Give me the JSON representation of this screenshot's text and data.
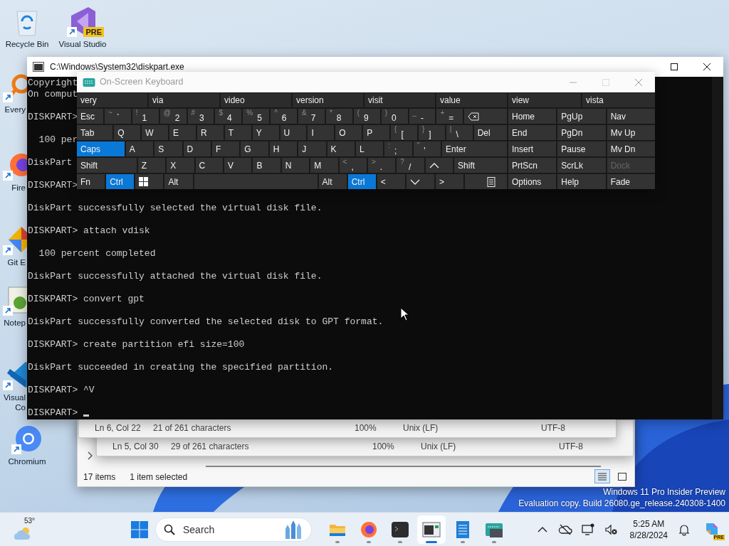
{
  "desktop_icons": [
    {
      "label": "Recycle Bin",
      "kind": "recycle"
    },
    {
      "label": "Visual Studio",
      "kind": "vs",
      "badge": "PRE"
    },
    {
      "label": "Every",
      "kind": "everything"
    },
    {
      "label": "Fire",
      "kind": "firefox"
    },
    {
      "label": "Git E",
      "kind": "git"
    },
    {
      "label": "Notep",
      "kind": "notepadpp"
    },
    {
      "label": "Visual Co",
      "kind": "vscode"
    },
    {
      "label": "Chromium",
      "kind": "chromium"
    }
  ],
  "explorer": {
    "item_count": "17 items",
    "selection": "1 item selected",
    "views": [
      {
        "kind": "details",
        "selected": true
      },
      {
        "kind": "tiles",
        "selected": false
      }
    ]
  },
  "notepad_status_bars": [
    {
      "cells": [
        "Ln 6, Col 22",
        "21 of 261 characters",
        "100%",
        "Unix (LF)",
        "UTF-8"
      ]
    },
    {
      "cells": [
        "Ln 5, Col 30",
        "29 of 261 characters",
        "100%",
        "Unix (LF)",
        "UTF-8"
      ]
    }
  ],
  "console": {
    "title": "C:\\Windows\\System32\\diskpart.exe",
    "lines": [
      {
        "text": "Copyright"
      },
      {
        "text": "On comput"
      },
      {
        "text": "DISKPART>"
      },
      {
        "text": "  100 per"
      },
      {
        "text": "DiskPart"
      },
      {
        "text": "DISKPART>"
      },
      {
        "text": "DiskPart successfully selected the virtual disk file."
      },
      {
        "text": "DISKPART> attach vdisk"
      },
      {
        "text": "  100 percent completed"
      },
      {
        "text": "DiskPart successfully attached the virtual disk file."
      },
      {
        "text": "DISKPART> convert gpt"
      },
      {
        "text": "DiskPart successfully converted the selected disk to GPT format."
      },
      {
        "text": "DISKPART> create partition efi size=100"
      },
      {
        "text": "DiskPart succeeded in creating the specified partition."
      },
      {
        "text": "DISKPART> ^V"
      },
      {
        "text": "DISKPART> "
      }
    ]
  },
  "keyboard": {
    "title": "On-Screen Keyboard",
    "suggestions": [
      "very",
      "via",
      "video",
      "version",
      "visit",
      "value"
    ],
    "nav_suggestions": [
      "view",
      "vista"
    ],
    "number_row": [
      {
        "kind": "key",
        "label": "Esc",
        "pressed": false
      },
      {
        "kind": "key",
        "shift": "~",
        "label": "`",
        "pressed": false
      },
      {
        "kind": "key",
        "shift": "!",
        "label": "1",
        "pressed": false
      },
      {
        "kind": "key",
        "shift": "@",
        "label": "2",
        "pressed": false
      },
      {
        "kind": "key",
        "shift": "#",
        "label": "3",
        "pressed": false
      },
      {
        "kind": "key",
        "shift": "$",
        "label": "4",
        "pressed": false
      },
      {
        "kind": "key",
        "shift": "%",
        "label": "5",
        "pressed": false
      },
      {
        "kind": "key",
        "shift": "^",
        "label": "6",
        "pressed": false
      },
      {
        "kind": "key",
        "shift": "&",
        "label": "7",
        "pressed": false
      },
      {
        "kind": "key",
        "shift": "*",
        "label": "8",
        "pressed": false
      },
      {
        "kind": "key",
        "shift": "(",
        "label": "9",
        "pressed": false
      },
      {
        "kind": "key",
        "shift": ")",
        "label": "0",
        "pressed": false
      },
      {
        "kind": "key",
        "shift": "_",
        "label": "-",
        "pressed": false
      },
      {
        "kind": "key",
        "shift": "+",
        "label": "=",
        "pressed": false
      },
      {
        "kind": "backspace",
        "pressed": false
      }
    ],
    "upper_row": [
      {
        "kind": "key",
        "label": "Tab",
        "pressed": false
      },
      {
        "kind": "key",
        "label": "Q",
        "pressed": false
      },
      {
        "kind": "key",
        "label": "W",
        "pressed": false
      },
      {
        "kind": "key",
        "label": "E",
        "pressed": false
      },
      {
        "kind": "key",
        "label": "R",
        "pressed": false
      },
      {
        "kind": "key",
        "label": "T",
        "pressed": false
      },
      {
        "kind": "key",
        "label": "Y",
        "pressed": false
      },
      {
        "kind": "key",
        "label": "U",
        "pressed": false
      },
      {
        "kind": "key",
        "label": "I",
        "pressed": false
      },
      {
        "kind": "key",
        "label": "O",
        "pressed": false
      },
      {
        "kind": "key",
        "label": "P",
        "pressed": false
      },
      {
        "kind": "key",
        "shift": "{",
        "label": "[",
        "pressed": false
      },
      {
        "kind": "key",
        "shift": "}",
        "label": "]",
        "pressed": false
      },
      {
        "kind": "key",
        "shift": "|",
        "label": "\\",
        "pressed": false
      },
      {
        "kind": "key",
        "label": "Del",
        "pressed": false
      }
    ],
    "home_row": [
      {
        "kind": "key",
        "label": "Caps",
        "pressed": true
      },
      {
        "kind": "key",
        "label": "A",
        "pressed": false
      },
      {
        "kind": "key",
        "label": "S",
        "pressed": false
      },
      {
        "kind": "key",
        "label": "D",
        "pressed": false
      },
      {
        "kind": "key",
        "label": "F",
        "pressed": false
      },
      {
        "kind": "key",
        "label": "G",
        "pressed": false
      },
      {
        "kind": "key",
        "label": "H",
        "pressed": false
      },
      {
        "kind": "key",
        "label": "J",
        "pressed": false
      },
      {
        "kind": "key",
        "label": "K",
        "pressed": false
      },
      {
        "kind": "key",
        "label": "L",
        "pressed": false
      },
      {
        "kind": "key",
        "shift": ":",
        "label": ";",
        "pressed": false
      },
      {
        "kind": "key",
        "shift": "\"",
        "label": "'",
        "pressed": false
      },
      {
        "kind": "key",
        "label": "Enter",
        "pressed": false
      }
    ],
    "lower_row": [
      {
        "kind": "key",
        "label": "Shift",
        "pressed": false
      },
      {
        "kind": "key",
        "label": "Z",
        "pressed": false
      },
      {
        "kind": "key",
        "label": "X",
        "pressed": false
      },
      {
        "kind": "key",
        "label": "C",
        "pressed": false
      },
      {
        "kind": "key",
        "label": "V",
        "pressed": false
      },
      {
        "kind": "key",
        "label": "B",
        "pressed": false
      },
      {
        "kind": "key",
        "label": "N",
        "pressed": false
      },
      {
        "kind": "key",
        "label": "M",
        "pressed": false
      },
      {
        "kind": "key",
        "shift": "<",
        "label": ",",
        "pressed": false
      },
      {
        "kind": "key",
        "shift": ">",
        "label": ".",
        "pressed": false
      },
      {
        "kind": "key",
        "shift": "?",
        "label": "/",
        "pressed": false
      },
      {
        "kind": "up",
        "pressed": false
      },
      {
        "kind": "key",
        "label": "Shift",
        "pressed": false
      }
    ],
    "bottom_row": [
      {
        "kind": "key",
        "label": "Fn",
        "pressed": false
      },
      {
        "kind": "key",
        "label": "Ctrl",
        "pressed": true
      },
      {
        "kind": "windows",
        "pressed": false
      },
      {
        "kind": "key",
        "label": "Alt",
        "pressed": false
      },
      {
        "kind": "space",
        "pressed": false
      },
      {
        "kind": "key",
        "label": "Alt",
        "pressed": false
      },
      {
        "kind": "key",
        "label": "Ctrl",
        "pressed": true
      },
      {
        "kind": "key",
        "label": "<",
        "pressed": false
      },
      {
        "kind": "down",
        "pressed": false
      },
      {
        "kind": "key",
        "label": ">",
        "pressed": false
      },
      {
        "kind": "menu",
        "pressed": false
      }
    ],
    "nav_rows": [
      [
        {
          "label": "Home",
          "disabled": false
        },
        {
          "label": "PgUp",
          "disabled": false
        },
        {
          "label": "Nav",
          "disabled": false
        }
      ],
      [
        {
          "label": "End",
          "disabled": false
        },
        {
          "label": "PgDn",
          "disabled": false
        },
        {
          "label": "Mv Up",
          "disabled": false
        }
      ],
      [
        {
          "label": "Insert",
          "disabled": false
        },
        {
          "label": "Pause",
          "disabled": false
        },
        {
          "label": "Mv Dn",
          "disabled": false
        }
      ],
      [
        {
          "label": "PrtScn",
          "disabled": false
        },
        {
          "label": "ScrLk",
          "disabled": false
        },
        {
          "label": "Dock",
          "disabled": true
        }
      ],
      [
        {
          "label": "Options",
          "disabled": false
        },
        {
          "label": "Help",
          "disabled": false
        },
        {
          "label": "Fade",
          "disabled": false
        }
      ]
    ]
  },
  "edition_notice": [
    "Windows 11 Pro Insider Preview",
    "Evaluation copy. Build 26080.ge_release.240308-1400"
  ],
  "taskbar": {
    "weather": "53°",
    "search": {
      "placeholder": "Search"
    },
    "apps": [
      {
        "kind": "folder",
        "selected": false
      },
      {
        "kind": "firefox",
        "selected": false
      },
      {
        "kind": "terminal",
        "selected": false
      },
      {
        "kind": "window",
        "selected": true
      },
      {
        "kind": "notepad",
        "selected": false
      },
      {
        "kind": "keyboard",
        "selected": false
      }
    ],
    "clock": {
      "time": "5:25 AM",
      "date": "8/28/2024"
    },
    "copilot_badge": "PRE"
  }
}
